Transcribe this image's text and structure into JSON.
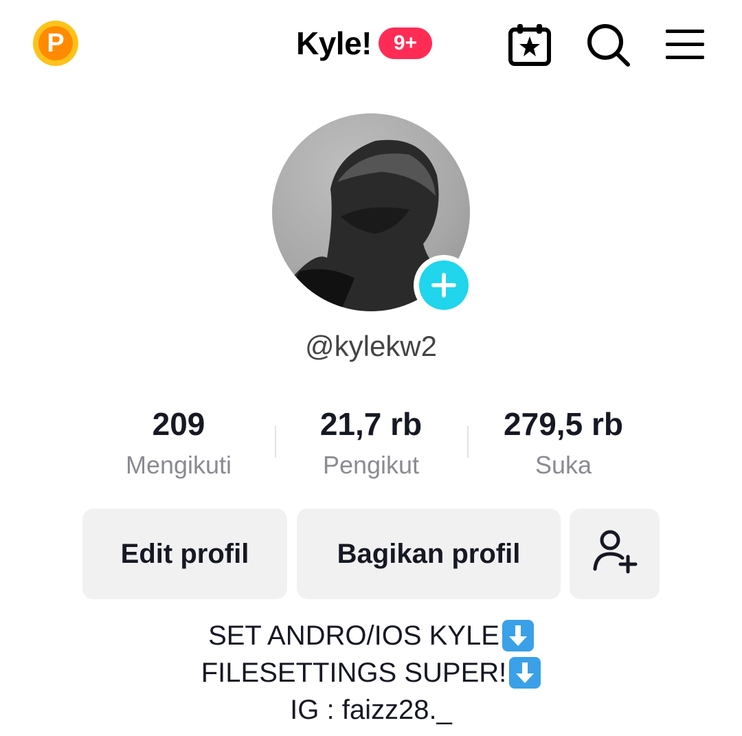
{
  "header": {
    "coin_letter": "P",
    "title": "Kyle!",
    "notification_badge": "9+"
  },
  "profile": {
    "handle": "@kylekw2",
    "stats": [
      {
        "value": "209",
        "label": "Mengikuti"
      },
      {
        "value": "21,7 rb",
        "label": "Pengikut"
      },
      {
        "value": "279,5 rb",
        "label": "Suka"
      }
    ]
  },
  "actions": {
    "edit_label": "Edit profil",
    "share_label": "Bagikan profil",
    "add_friend_icon": "add-person-icon"
  },
  "bio": {
    "line1": "SET ANDRO/IOS KYLE",
    "line2": "FILESETTINGS SUPER!",
    "line3": "IG : faizz28._",
    "emoji": "down-arrow-emoji"
  },
  "colors": {
    "badge": "#FE2C55",
    "add_avatar": "#20D5EC",
    "coin": "#FFC21A",
    "button_bg": "#F1F1F2"
  }
}
